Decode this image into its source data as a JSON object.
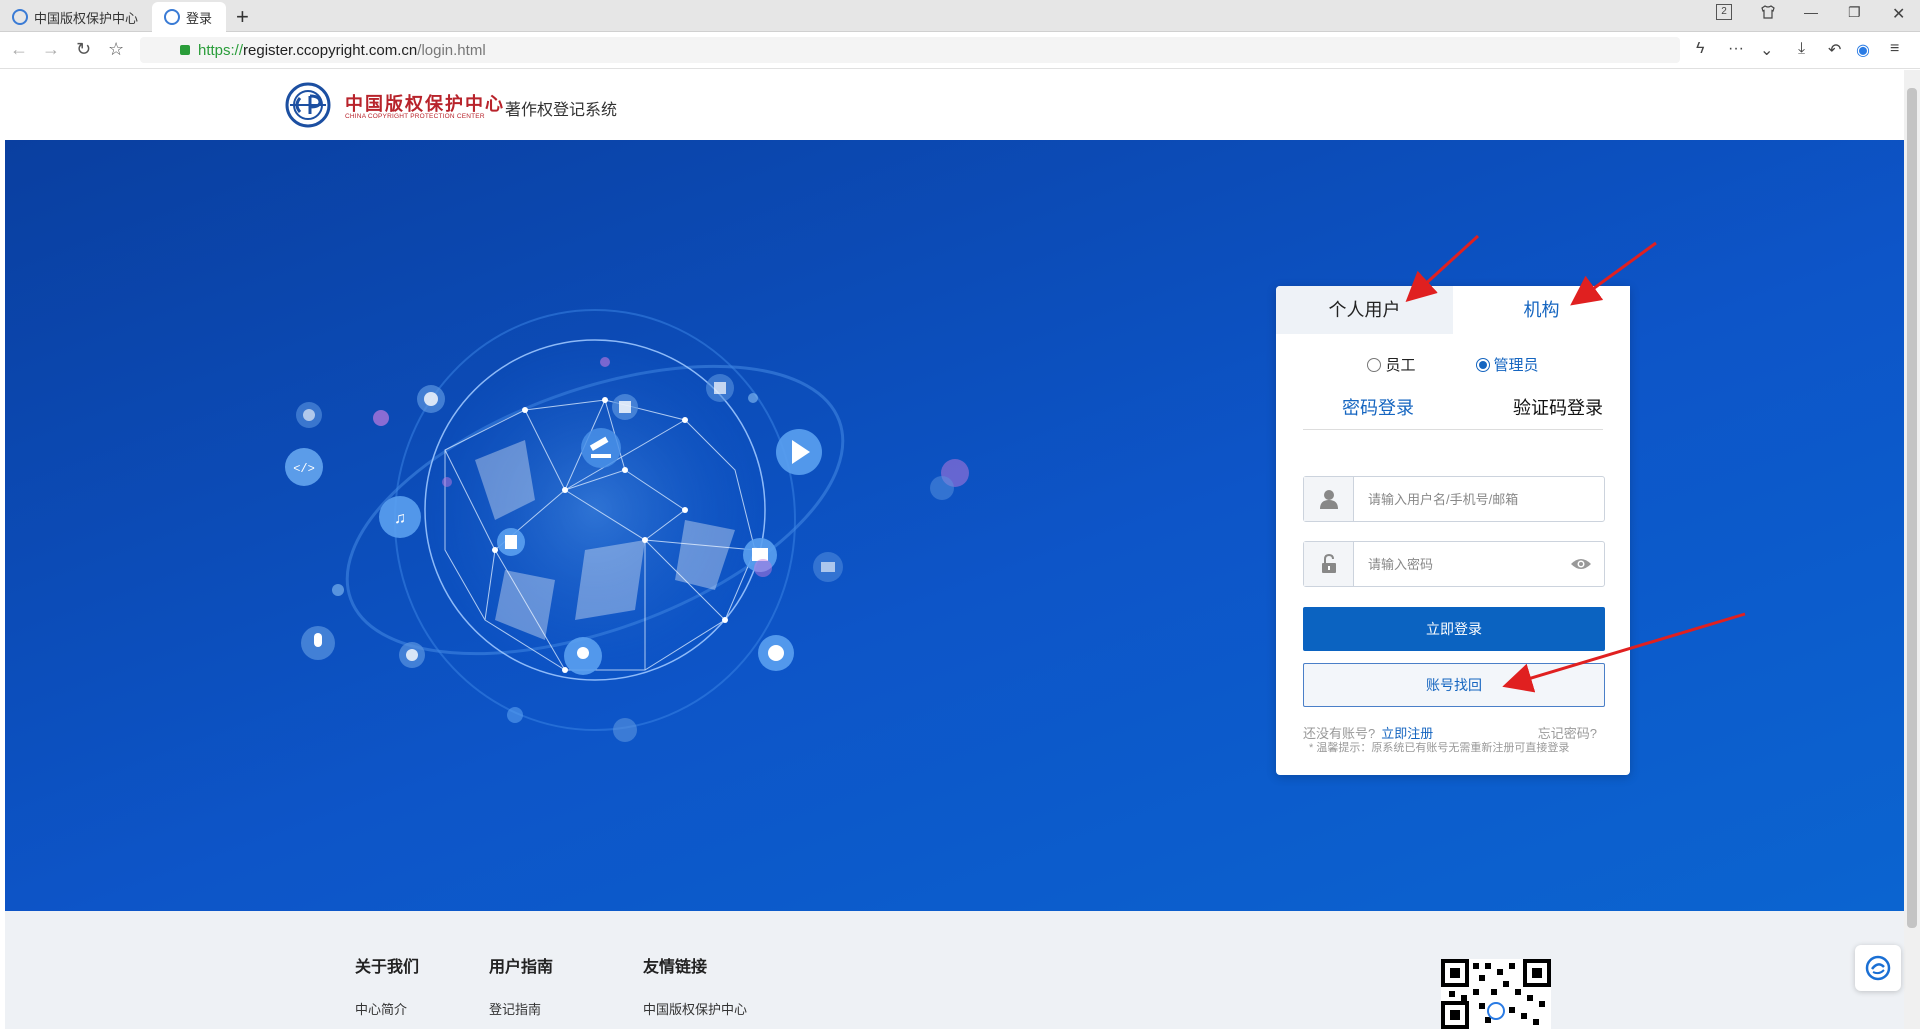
{
  "browser": {
    "tabs": [
      {
        "title": "中国版权保护中心"
      },
      {
        "title": "登录"
      }
    ],
    "url": {
      "protocol": "https://",
      "host": "register.ccopyright.com.cn",
      "path": "/login.html"
    },
    "tab_count_badge": "2"
  },
  "site": {
    "logo_cn": "中国版权保护中心",
    "logo_en": "CHINA COPYRIGHT PROTECTION CENTER",
    "system_name": "著作权登记系统"
  },
  "login": {
    "tabs": [
      "个人用户",
      "机构"
    ],
    "roles": [
      "员工",
      "管理员"
    ],
    "selected_role": "管理员",
    "modes": [
      "密码登录",
      "验证码登录"
    ],
    "username_placeholder": "请输入用户名/手机号/邮箱",
    "password_placeholder": "请输入密码",
    "login_button": "立即登录",
    "recover_button": "账号找回",
    "no_account": "还没有账号?",
    "register": "立即注册",
    "forgot": "忘记密码?",
    "hint": "* 温馨提示：原系统已有账号无需重新注册可直接登录"
  },
  "footer": {
    "columns": [
      {
        "heading": "关于我们",
        "link": "中心简介"
      },
      {
        "heading": "用户指南",
        "link": "登记指南"
      },
      {
        "heading": "友情链接",
        "link": "中国版权保护中心"
      }
    ]
  },
  "colors": {
    "hero_blue": "#0d55c8",
    "primary": "#0b63c1",
    "brand_red": "#b8232b",
    "annotation_red": "#e02020"
  }
}
